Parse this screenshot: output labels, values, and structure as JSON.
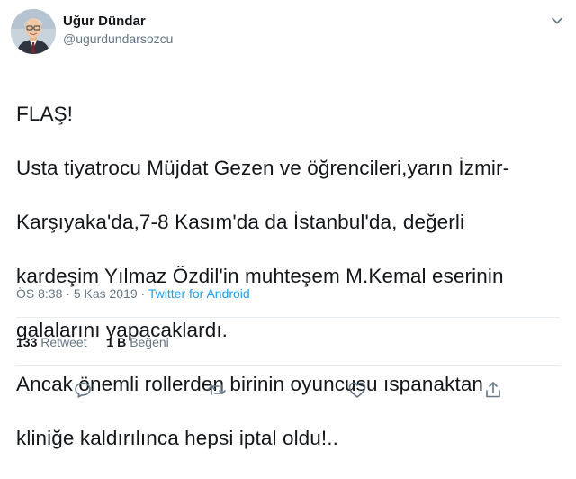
{
  "author": {
    "display_name": "Uğur Dündar",
    "handle": "@ugurdundarsozcu"
  },
  "tweet": {
    "text_lines": [
      "FLAŞ!",
      "Usta tiyatrocu Müjdat Gezen ve öğrencileri,yarın İzmir-",
      "Karşıyaka'da,7-8 Kasım'da da İstanbul'da, değerli",
      "kardeşim Yılmaz Özdil'in muhteşem M.Kemal eserinin",
      "galalarını yapacaklardı.",
      "Ancak önemli rollerden birinin oyuncusu ıspanaktan",
      "kliniğe kaldırılınca hepsi iptal oldu!.."
    ]
  },
  "meta": {
    "time": "ÖS 8:38",
    "separator": " · ",
    "date": "5 Kas 2019",
    "source": "Twitter for Android"
  },
  "stats": {
    "retweets_count": "133",
    "retweets_label": "Retweet",
    "likes_count": "1 B",
    "likes_label": "Beğeni"
  },
  "icons": {
    "caret": "chevron-down-icon",
    "reply": "reply-icon",
    "retweet": "retweet-icon",
    "like": "heart-icon",
    "share": "share-icon"
  },
  "colors": {
    "text": "#14171a",
    "secondary": "#657786",
    "link": "#1da1f2",
    "divider": "#e6ecf0"
  }
}
